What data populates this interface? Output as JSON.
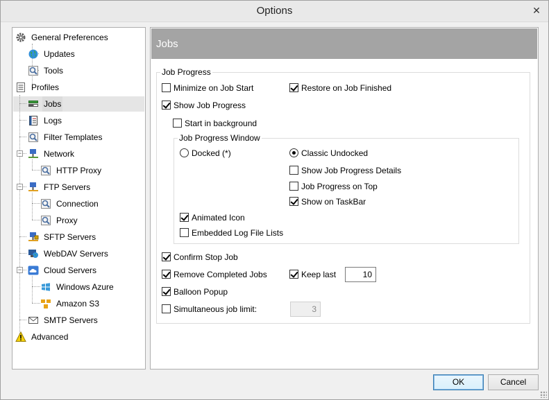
{
  "window": {
    "title": "Options",
    "close_glyph": "✕"
  },
  "tree": {
    "items": [
      {
        "label": "General Preferences",
        "icon": "gear-icon"
      },
      {
        "label": "Updates",
        "icon": "globe-icon"
      },
      {
        "label": "Tools",
        "icon": "tools-icon"
      },
      {
        "label": "Profiles",
        "icon": "profiles-icon"
      },
      {
        "label": "Jobs",
        "icon": "jobs-icon"
      },
      {
        "label": "Logs",
        "icon": "logs-icon"
      },
      {
        "label": "Filter Templates",
        "icon": "filter-icon"
      },
      {
        "label": "Network",
        "icon": "network-icon"
      },
      {
        "label": "HTTP Proxy",
        "icon": "proxy-icon"
      },
      {
        "label": "FTP Servers",
        "icon": "ftp-icon"
      },
      {
        "label": "Connection",
        "icon": "connection-icon"
      },
      {
        "label": "Proxy",
        "icon": "proxy-icon"
      },
      {
        "label": "SFTP Servers",
        "icon": "sftp-icon"
      },
      {
        "label": "WebDAV Servers",
        "icon": "webdav-icon"
      },
      {
        "label": "Cloud Servers",
        "icon": "cloud-icon"
      },
      {
        "label": "Windows Azure",
        "icon": "azure-icon"
      },
      {
        "label": "Amazon S3",
        "icon": "s3-icon"
      },
      {
        "label": "SMTP Servers",
        "icon": "mail-icon"
      },
      {
        "label": "Advanced",
        "icon": "warning-icon"
      }
    ],
    "selected": "Jobs"
  },
  "panel": {
    "header": "Jobs",
    "job_progress_group": "Job Progress",
    "minimize_on_job_start": "Minimize on Job Start",
    "restore_on_job_finished": "Restore on Job Finished",
    "show_job_progress": "Show Job Progress",
    "start_in_background": "Start in background",
    "job_progress_window_group": "Job Progress Window",
    "docked": "Docked (*)",
    "classic_undocked": "Classic Undocked",
    "show_job_progress_details": "Show Job Progress Details",
    "job_progress_on_top": "Job Progress on Top",
    "show_on_taskbar": "Show on TaskBar",
    "animated_icon": "Animated Icon",
    "embedded_log_file_lists": "Embedded Log File Lists",
    "confirm_stop_job": "Confirm Stop Job",
    "remove_completed_jobs": "Remove Completed Jobs",
    "keep_last": "Keep last",
    "keep_last_value": "10",
    "balloon_popup": "Balloon Popup",
    "simultaneous_job_limit": "Simultaneous job limit:",
    "simultaneous_job_limit_value": "3"
  },
  "buttons": {
    "ok": "OK",
    "cancel": "Cancel"
  }
}
